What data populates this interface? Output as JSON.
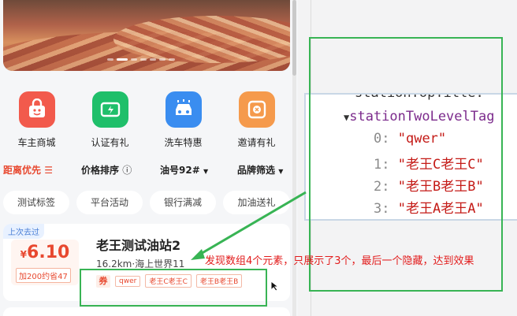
{
  "quick_entries": [
    {
      "label": "车主商城",
      "icon": "gift-bag-icon",
      "color": "#f25a4c"
    },
    {
      "label": "认证有礼",
      "icon": "battery-icon",
      "color": "#1fbf6a"
    },
    {
      "label": "洗车特惠",
      "icon": "car-wash-icon",
      "color": "#3a8df0"
    },
    {
      "label": "邀请有礼",
      "icon": "coupon-icon",
      "color": "#f59a4c"
    }
  ],
  "filters": {
    "distance": "距离优先",
    "price": "价格排序",
    "oil": "油号92#",
    "brand": "品牌筛选"
  },
  "tags": [
    "测试标签",
    "平台活动",
    "银行满减",
    "加油送礼"
  ],
  "station": {
    "last_visited": "上次去过",
    "currency": "¥",
    "price": "6.10",
    "saving": "加200约省47",
    "name": "老王测试油站2",
    "distance": "16.2km·海上世界11",
    "coupon_badge": "券",
    "coupons": [
      "qwer",
      "老王C老王C",
      "老王B老王B"
    ]
  },
  "devtools": {
    "line0": "stationTopTitle: '",
    "key": "stationTwoLevelTag",
    "items": [
      {
        "index": "0:",
        "value": "\"qwer\""
      },
      {
        "index": "1:",
        "value": "\"老王C老王C\""
      },
      {
        "index": "2:",
        "value": "\"老王B老王B\""
      },
      {
        "index": "3:",
        "value": "\"老王A老王A\""
      }
    ]
  },
  "annotation": "发现数组4个元素，只展示了3个，最后一个隐藏，达到效果",
  "colors": {
    "accent": "#e8482f",
    "annotation_box": "#38b454",
    "annotation_text": "#e21b1b"
  }
}
